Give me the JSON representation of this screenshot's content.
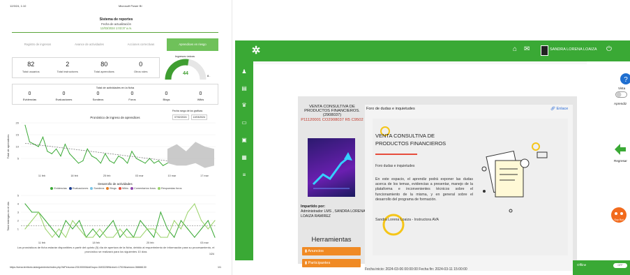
{
  "report": {
    "header_date": "12/3/24, 1:10",
    "header_app": "Microsoft Power BI",
    "title": "Sistema de reportes",
    "update_label": "Fecha de actualización",
    "update_date": "12/03/2024 1:03:37 a.m.",
    "tabs": [
      "Registro de ingresos",
      "Avance de actividades",
      "Acciones correctivas",
      "Aprendices en riesgo"
    ],
    "kpis": [
      {
        "value": "82",
        "label": "Total usuarios"
      },
      {
        "value": "2",
        "label": "Total instructores"
      },
      {
        "value": "80",
        "label": "Total aprendices"
      },
      {
        "value": "0",
        "label": "Otros roles"
      }
    ],
    "gauge": {
      "title": "Ingresos únicos",
      "value": "44",
      "max": "8..",
      "fraction": 0.55
    },
    "activities_title": "Total de actividades en la ficha",
    "activities": [
      {
        "value": "0",
        "label": "Evidencias"
      },
      {
        "value": "0",
        "label": "Evaluaciones"
      },
      {
        "value": "0",
        "label": "Sondeos"
      },
      {
        "value": "0",
        "label": "Foros"
      },
      {
        "value": "0",
        "label": "Blogs"
      },
      {
        "value": "0",
        "label": "Wikis"
      }
    ],
    "range_label": "Fecha rango de los gráficas",
    "range_from": "07/02/2024",
    "range_to": "12/03/2024",
    "chart1_title": "Pronóstico de ingreso de aprendices",
    "chart1_ylabel": "Total de aprendices",
    "chart2_title": "Desarrollo de actividades",
    "chart2_ylabel": "Total entregas en el día",
    "legend": [
      {
        "name": "Evidencias",
        "color": "#3aa935"
      },
      {
        "name": "Evaluaciones",
        "color": "#1b3d8f"
      },
      {
        "name": "Sondeos",
        "color": "#7ac4e6"
      },
      {
        "name": "Blogs",
        "color": "#e67e22"
      },
      {
        "name": "Wikis",
        "color": "#e74c3c"
      },
      {
        "name": "Comentarios foros",
        "color": "#8e44ad"
      },
      {
        "name": "Respuestas foros",
        "color": "#9bd36a"
      }
    ],
    "footnote": "Los pronósticos de ficha estarán disponibles a partir del quinto (5) día de apertura de la ficha, debido al requerimiento de información para su procesamiento, el pronóstico se realizará para los siguientes 10 días",
    "page_pct": "1/24",
    "url": "https://sena.territorio.la/seguimiento/index.php?idPersona=23100000&idGrupo=34032289&nivel=17019&sesion=36666130",
    "page_num": "1/1"
  },
  "chart_data": [
    {
      "type": "line",
      "title": "Pronóstico de ingreso de aprendices",
      "ylabel": "Total de aprendices",
      "ylim": [
        0,
        20
      ],
      "yticks": [
        5,
        10,
        15,
        20
      ],
      "xticks": [
        "11 feb",
        "18 feb",
        "25 feb",
        "03 mar",
        "10 mar",
        "17 mar"
      ],
      "series": [
        {
          "values": [
            19,
            12,
            11,
            10,
            14,
            8,
            7,
            9,
            6,
            11,
            7,
            5,
            3,
            4,
            9,
            6,
            5,
            3,
            7,
            4,
            3,
            6,
            5,
            3,
            8,
            5,
            4,
            3,
            5,
            3,
            4,
            2,
            3
          ]
        }
      ],
      "forecast_band": [
        [
          3,
          9
        ],
        [
          2,
          11
        ],
        [
          2,
          8
        ],
        [
          3,
          12
        ],
        [
          1,
          10
        ],
        [
          2,
          9
        ]
      ]
    },
    {
      "type": "line",
      "title": "Desarrollo de actividades",
      "ylabel": "Total entregas en el día",
      "ylim": [
        0,
        5
      ],
      "yticks": [
        1,
        2,
        3,
        4,
        5
      ],
      "xticks": [
        "11 feb",
        "18 feb",
        "25 feb",
        "03 mar"
      ],
      "series": [
        {
          "name": "Evidencias",
          "values": [
            4,
            3,
            3,
            2,
            1,
            0,
            2,
            1,
            2,
            0,
            1,
            0,
            1,
            2,
            0,
            1,
            0,
            2,
            1,
            0,
            3,
            1,
            0,
            2,
            1,
            0,
            1,
            2,
            0
          ]
        },
        {
          "name": "Respuestas foros",
          "values": [
            1,
            2,
            3,
            1,
            0,
            1,
            0,
            2,
            1,
            0,
            0,
            1,
            0,
            0,
            1,
            0,
            0,
            0,
            1,
            1,
            0,
            0,
            2,
            1,
            3,
            4,
            2,
            1,
            2
          ]
        }
      ]
    }
  ],
  "sena": {
    "username": "SANDRA LORENA LOAIZA",
    "course_name": "VENTA CONSULTIVA DE PRODUCTOS FINANCIEROS. (2908037)",
    "course_code": "P11120001 CO2908037 R5 C9502",
    "imparted_label": "Impartido por:",
    "imparted_by": "Administrador LMS , SANDRA LORENA LOAIZA RAMIREZ",
    "tools_title": "Herramientas",
    "tools": [
      "Anuncios",
      "Participantes"
    ],
    "forum_header": "Foro de dudas e inquietudes",
    "link_label": "Enlace",
    "card_title": "VENTA CONSULTIVA DE PRODUCTOS FINANCIEROS",
    "card_subtitle": "Foro dudas e inquietudes",
    "card_body": "En este espacio, el aprendiz podrá exponer las dudas acerca de los temas, evidencias a presentar, manejo de la plataforma e inconvenientes técnicos sobre el funcionamiento de la misma, y en general sobre el desarrollo del programa de formación.",
    "card_signature": "Sandra Lorena Loaiza - Instructora AVA",
    "dates": "Fecha inicio: 2024-03-06 00:00:00  Fecha fin: 2024-03-11 15:00:00",
    "vista_label": "Vista",
    "aprendiz_label": "Aprendiz",
    "regresar_label": "Regresar",
    "offline_label": "Offline",
    "offline_state": "OFF",
    "bot_label": "Soy Bot",
    "brand_green": "#3aa935"
  }
}
